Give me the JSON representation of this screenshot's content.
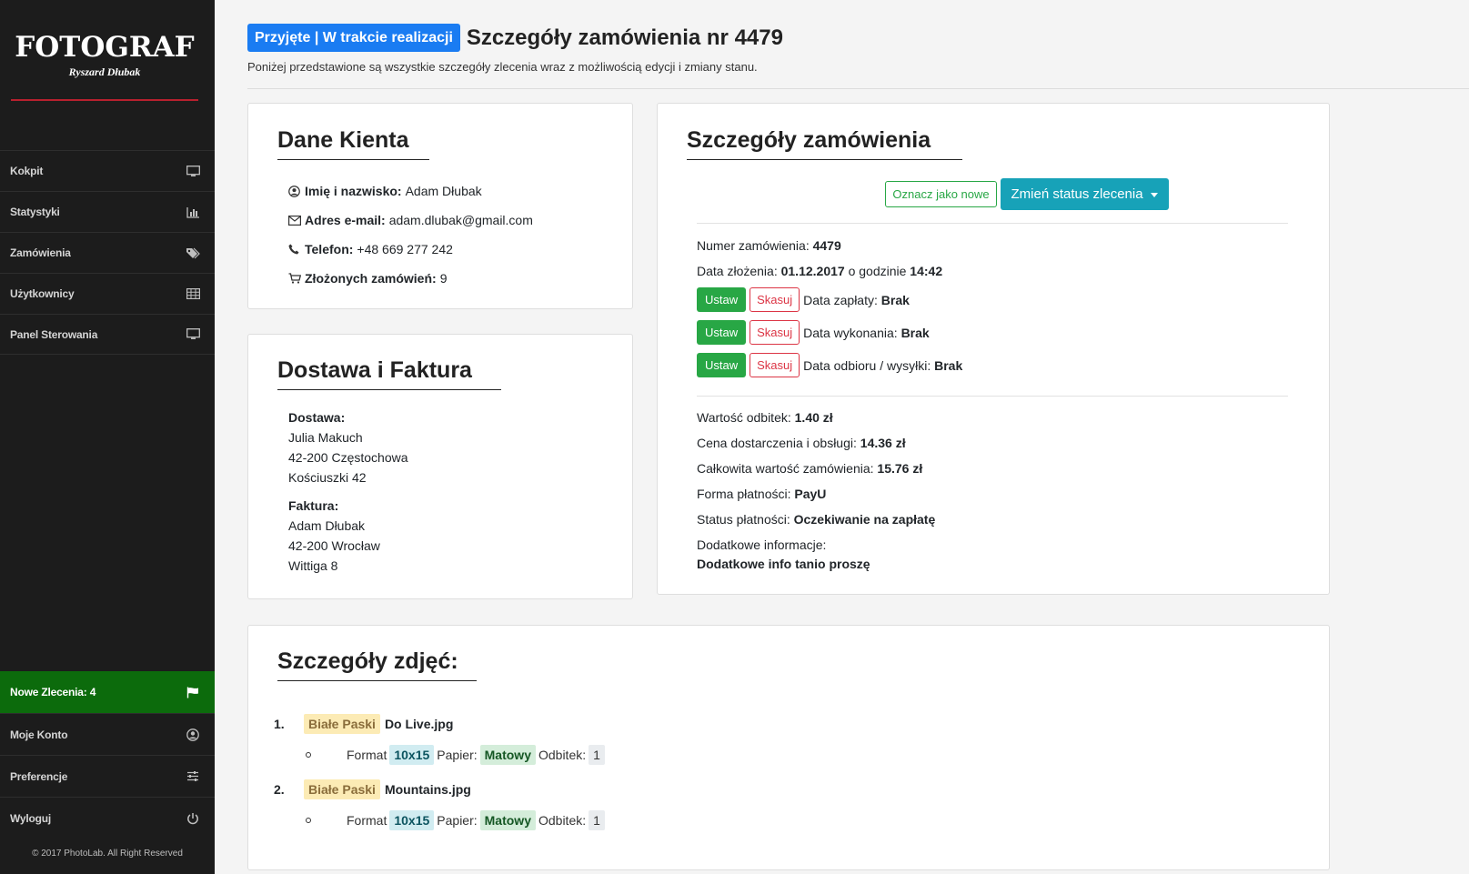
{
  "brand": {
    "name": "FOTOGRAF",
    "tagline": "Ryszard Dłubak"
  },
  "sidebar": {
    "items": [
      {
        "label": "Kokpit",
        "icon": "monitor-icon"
      },
      {
        "label": "Statystyki",
        "icon": "bar-chart-icon"
      },
      {
        "label": "Zamówienia",
        "icon": "tags-icon"
      },
      {
        "label": "Użytkownicy",
        "icon": "table-icon"
      },
      {
        "label": "Panel Sterowania",
        "icon": "monitor-icon"
      }
    ],
    "bottom": [
      {
        "label": "Nowe Zlecenia: 4",
        "icon": "flag-icon",
        "active": true
      },
      {
        "label": "Moje Konto",
        "icon": "user-circle-icon"
      },
      {
        "label": "Preferencje",
        "icon": "sliders-icon"
      },
      {
        "label": "Wyloguj",
        "icon": "power-icon"
      }
    ],
    "copyright": "© 2017 PhotoLab. All Right Reserved"
  },
  "header": {
    "status": "Przyjęte | W trakcie realizacji",
    "title": "Szczegóły zamówienia nr 4479",
    "subtitle": "Poniżej przedstawione są wszystkie szczegóły zlecenia wraz z możliwością edycji i zmiany stanu."
  },
  "client": {
    "title": "Dane Kienta",
    "name_label": "Imię i nazwisko:",
    "name": "Adam Dłubak",
    "email_label": "Adres e-mail:",
    "email": "adam.dlubak@gmail.com",
    "phone_label": "Telefon:",
    "phone": "+48 669 277 242",
    "orders_label": "Złożonych zamówień:",
    "orders": "9"
  },
  "delivery": {
    "title": "Dostawa i Faktura",
    "delivery_label": "Dostawa:",
    "delivery_lines": [
      "Julia Makuch",
      "42-200 Częstochowa",
      "Kościuszki 42"
    ],
    "invoice_label": "Faktura:",
    "invoice_lines": [
      "Adam Dłubak",
      "42-200 Wrocław",
      "Wittiga 8"
    ]
  },
  "order": {
    "title": "Szczegóły zamówienia",
    "mark_new": "Oznacz jako nowe",
    "change_status": "Zmień status zlecenia",
    "number_label": "Numer zamówienia:",
    "number": "4479",
    "date_label": "Data złożenia:",
    "date": "01.12.2017",
    "date_mid": "o godzinie",
    "time": "14:42",
    "set_label": "Ustaw",
    "clear_label": "Skasuj",
    "dates": [
      {
        "label": "Data zapłaty:",
        "value": "Brak"
      },
      {
        "label": "Data wykonania:",
        "value": "Brak"
      },
      {
        "label": "Data odbioru / wysyłki:",
        "value": "Brak"
      }
    ],
    "prints_label": "Wartość odbitek:",
    "prints": "1.40 zł",
    "shipping_label": "Cena dostarczenia i obsługi:",
    "shipping": "14.36 zł",
    "total_label": "Całkowita wartość zamówienia:",
    "total": "15.76 zł",
    "payment_form_label": "Forma płatności:",
    "payment_form": "PayU",
    "payment_status_label": "Status płatności:",
    "payment_status": "Oczekiwanie na zapłatę",
    "extra_label": "Dodatkowe informacje:",
    "extra": "Dodatkowe info tanio proszę"
  },
  "photos": {
    "title": "Szczegóły zdjęć:",
    "format_label": "Format",
    "paper_label": "Papier:",
    "copies_label": "Odbitek:",
    "items": [
      {
        "num": "1.",
        "tag": "Białe Paski",
        "file": "Do Live.jpg",
        "format": "10x15",
        "paper": "Matowy",
        "copies": "1"
      },
      {
        "num": "2.",
        "tag": "Białe Paski",
        "file": "Mountains.jpg",
        "format": "10x15",
        "paper": "Matowy",
        "copies": "1"
      }
    ]
  },
  "colors": {
    "sidebar": "#1c1c1c",
    "active_nav": "#0c6b0c",
    "status_badge": "#1a7cf2",
    "info_button": "#17a2b8",
    "success": "#28a745",
    "danger": "#dc3545"
  }
}
